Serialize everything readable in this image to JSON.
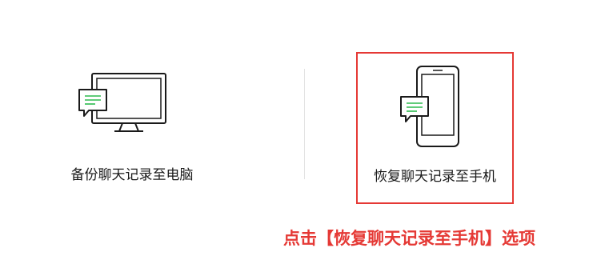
{
  "options": [
    {
      "label": "备份聊天记录至电脑",
      "icon": "desktop-chat-icon"
    },
    {
      "label": "恢复聊天记录至手机",
      "icon": "phone-chat-icon"
    }
  ],
  "annotation": "点击【恢复聊天记录至手机】选项",
  "colors": {
    "highlight": "#e53935",
    "bubble_lines": "#2dbb4e",
    "outline": "#1a1a1a"
  }
}
